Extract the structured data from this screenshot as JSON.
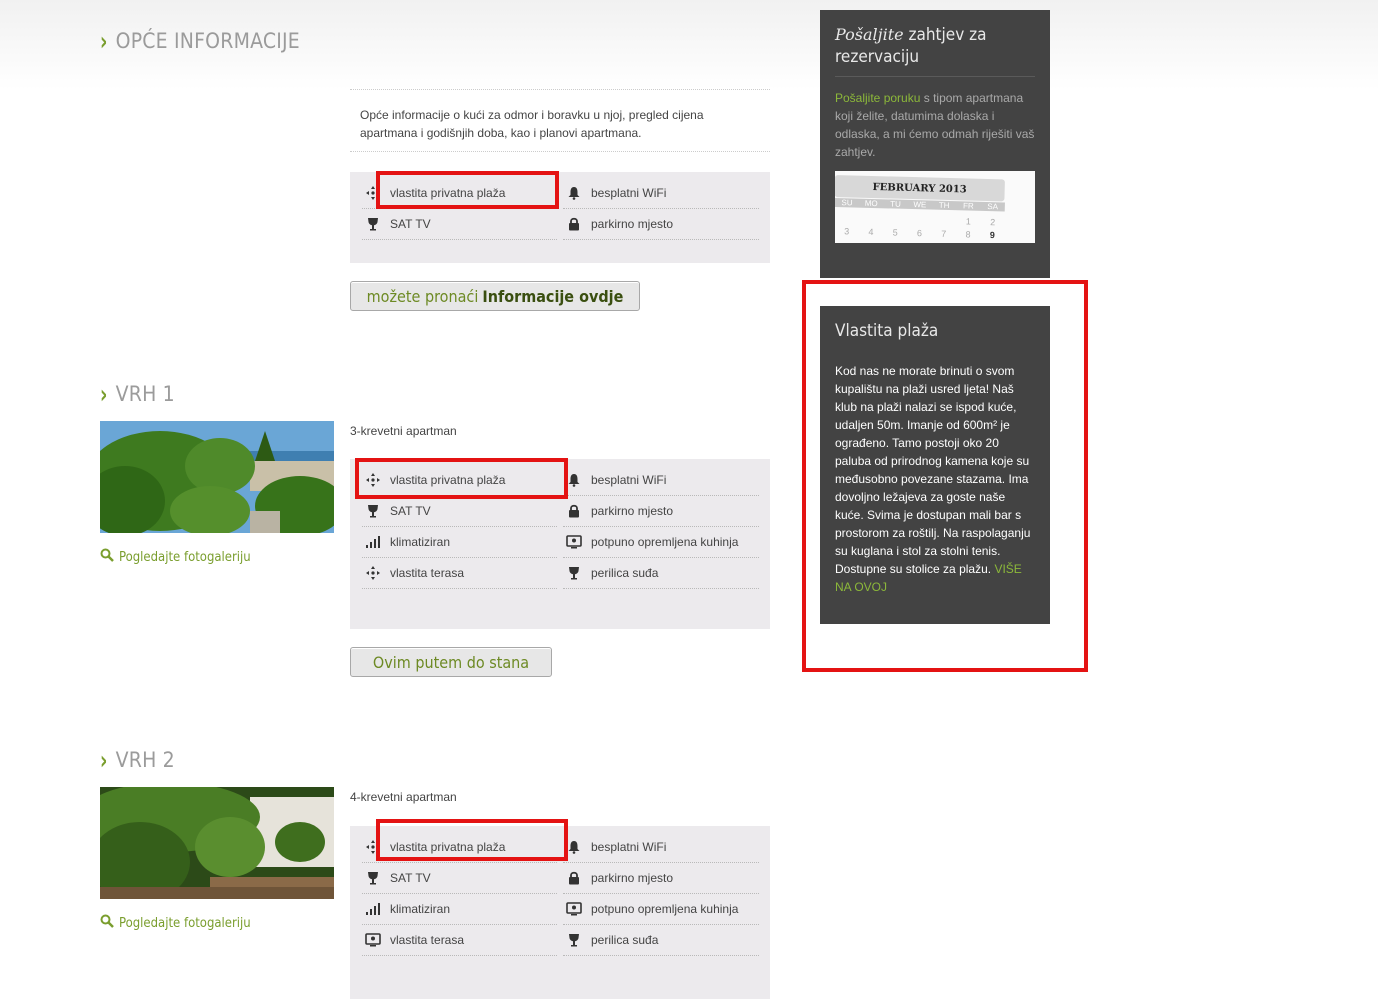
{
  "sections": {
    "general": {
      "title": "OPĆE INFORMACIJE",
      "description": "Opće informacije o kući za odmor i boravku u njoj, pregled cijena apartmana i godišnjih doba, kao i planovi apartmana.",
      "amenities": [
        "vlastita privatna plaža",
        "besplatni WiFi",
        "SAT TV",
        "parkirno mjesto"
      ],
      "button_prefix": "možete pronaći",
      "button_bold": "Informacije ovdje"
    },
    "vrh1": {
      "title": "VRH 1",
      "type": "3-krevetni apartman",
      "gallery_link": "Pogledajte fotogaleriju",
      "amenities": [
        "vlastita privatna plaža",
        "besplatni WiFi",
        "SAT TV",
        "parkirno mjesto",
        "klimatiziran",
        "potpuno opremljena kuhinja",
        "vlastita terasa",
        "perilica suđa"
      ],
      "button": "Ovim putem do stana"
    },
    "vrh2": {
      "title": "VRH 2",
      "type": "4-krevetni apartman",
      "gallery_link": "Pogledajte fotogaleriju",
      "amenities": [
        "vlastita privatna plaža",
        "besplatni WiFi",
        "SAT TV",
        "parkirno mjesto",
        "klimatiziran",
        "potpuno opremljena kuhinja",
        "vlastita terasa",
        "perilica suđa"
      ]
    }
  },
  "sidebar": {
    "reservation": {
      "title_italic": "Pošaljite",
      "title_rest": "zahtjev za rezervaciju",
      "link": "Pošaljite poruku",
      "text": "s tipom apartmana koji želite, datumima dolaska i odlaska, a mi ćemo odmah riješiti vaš zahtjev.",
      "calendar": {
        "month": "FEBRUARY 2013",
        "days_header": [
          "SU",
          "MO",
          "TU",
          "WE",
          "TH",
          "FR",
          "SA"
        ],
        "row1": [
          "",
          "",
          "",
          "",
          "",
          "1",
          "2"
        ],
        "row2": [
          "3",
          "4",
          "5",
          "6",
          "7",
          "8",
          "9"
        ]
      }
    },
    "beach": {
      "title": "Vlastita plaža",
      "text": "Kod nas ne morate brinuti o svom kupalištu na plaži usred ljeta! Naš klub na plaži nalazi se ispod kuće, udaljen 50m. Imanje od 600m² je ograđeno. Tamo postoji oko 20 paluba od prirodnog kamena koje su međusobno povezane stazama. Ima dovoljno ležajeva za goste naše kuće. Svima je dostupan mali bar s prostorom za roštilj. Na raspolaganju su kuglana i stol za stolni tenis. Dostupne su stolice za plažu.",
      "more_link": "VIŠE NA OVOJ"
    }
  },
  "colors": {
    "accent": "#7a9e2e",
    "panel": "#434343",
    "highlight": "#e41313",
    "amenity_bg": "#eceaed"
  }
}
